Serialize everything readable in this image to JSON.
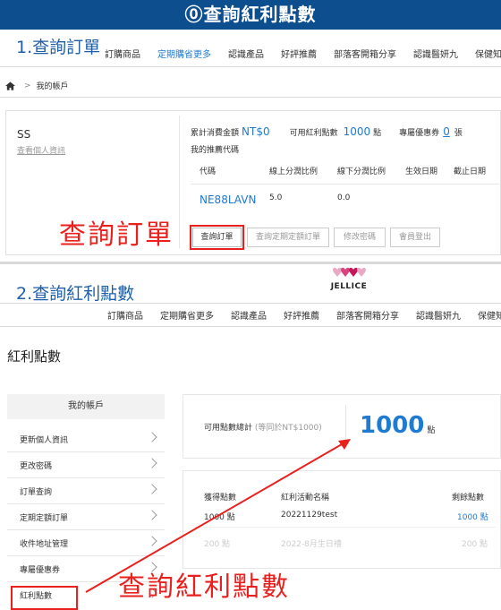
{
  "banner": "⓪查詢紅利點數",
  "section1": {
    "title": "1.查詢訂單",
    "nav": [
      "訂購商品",
      "定期購省更多",
      "認識產品",
      "好評推薦",
      "部落客開箱分享",
      "認識醫妍九",
      "保健知識+"
    ],
    "nav_active": 1,
    "breadcrumb_home": "home-icon",
    "breadcrumb_current": "我的帳戶",
    "breadcrumb_sep": ">",
    "account": {
      "name": "SS",
      "profile_link": "查看個人資訊",
      "total_label": "累計消費金額",
      "total_value": "NT$0",
      "points_label": "可用紅利點數",
      "points_value": "1000",
      "points_unit": "點",
      "coupon_label": "專屬優惠券",
      "coupon_value": "0",
      "coupon_unit": "張",
      "referral_label": "我的推薦代碼",
      "table_headers": [
        "代碼",
        "線上分潤比例",
        "線下分潤比例",
        "生效日期",
        "截止日期"
      ],
      "table_row": [
        "NE88LAVN",
        "5.0",
        "0.0",
        "",
        ""
      ],
      "buttons": [
        "查詢訂單",
        "查詢定期定額訂單",
        "修改密碼",
        "會員登出"
      ]
    },
    "callout": "查詢訂單"
  },
  "section2": {
    "title": "2.查詢紅利點數",
    "logo": "JELLICE",
    "nav": [
      "訂購商品",
      "定期購省更多",
      "認識產品",
      "好評推薦",
      "部落客開箱分享",
      "認識醫妍九",
      "保健知識+"
    ],
    "page_title": "紅利點數",
    "sidebar_title": "我的帳戶",
    "sidebar_items": [
      "更新個人資訊",
      "更改密碼",
      "訂單查詢",
      "定期定額訂單",
      "收件地址管理",
      "專屬優惠券",
      "紅利點數"
    ],
    "points_label": "可用點數總計",
    "points_note": "(等同於NT$1000)",
    "points_value": "1000",
    "points_unit": "點",
    "history_headers": [
      "獲得點數",
      "紅利活動名稱",
      "剩餘點數"
    ],
    "history_rows": [
      [
        "1000 點",
        "20221129test",
        "1000 點"
      ],
      [
        "200 點",
        "2022-8月生日禮",
        "200 點"
      ]
    ],
    "callout": "查詢紅利點數"
  },
  "colors": {
    "banner": "#0d4e8f",
    "accent": "#1f7ad1",
    "callout": "#e8201e"
  }
}
